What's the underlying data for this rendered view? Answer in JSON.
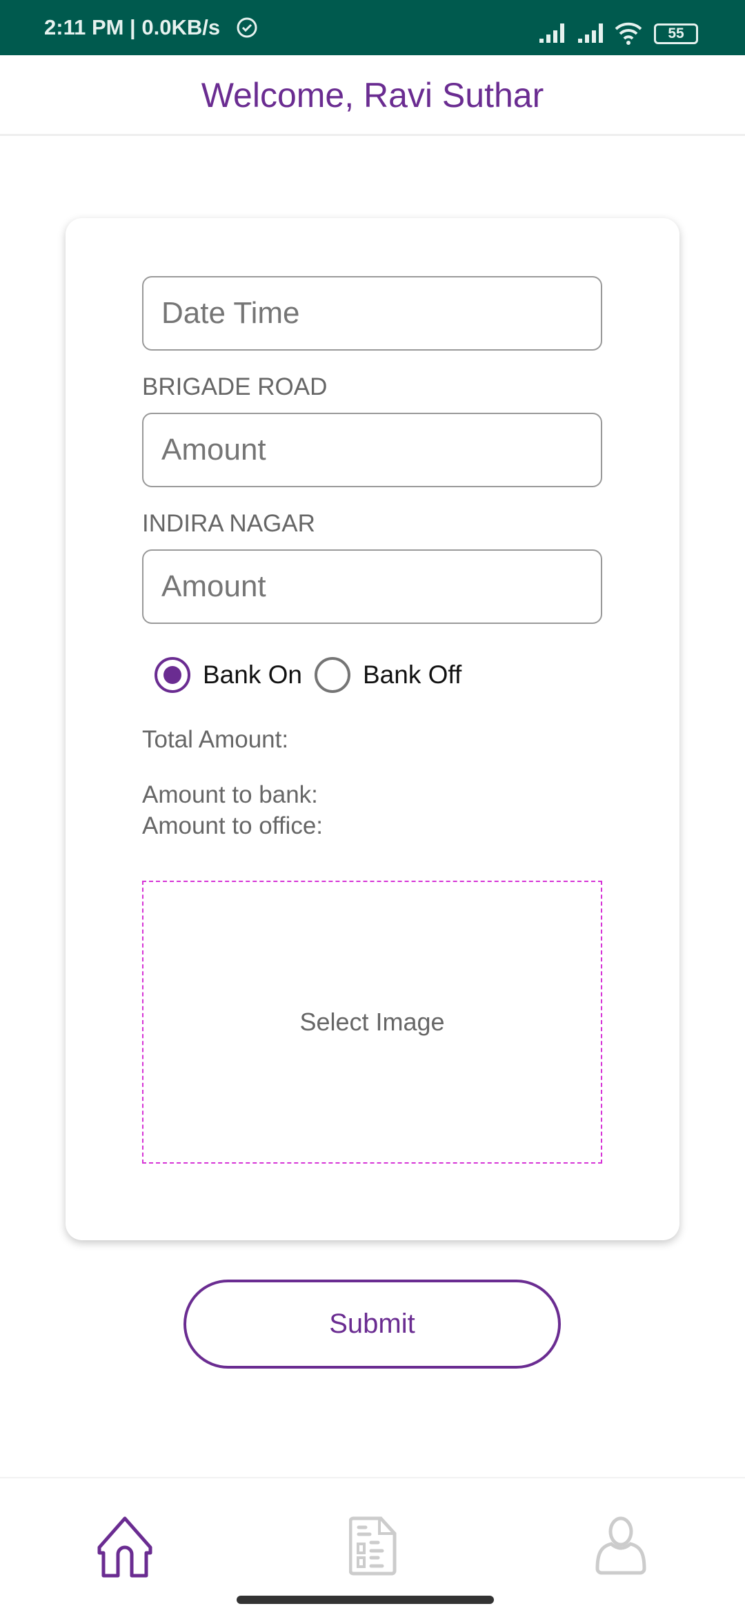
{
  "status_bar": {
    "time": "2:11 PM | 0.0KB/s",
    "battery": "55",
    "icons": [
      "alarm-icon",
      "signal-icon",
      "signal-icon",
      "wifi-icon",
      "battery-icon"
    ]
  },
  "header": {
    "title": "Welcome, Ravi Suthar"
  },
  "form": {
    "datetime_placeholder": "Date Time",
    "brigade_label": "BRIGADE ROAD",
    "brigade_placeholder": "Amount",
    "indira_label": "INDIRA NAGAR",
    "indira_placeholder": "Amount",
    "radio_bank_on": "Bank On",
    "radio_bank_off": "Bank Off",
    "selected": "Bank On",
    "total_amount": "Total Amount:",
    "amount_to_bank": "Amount to bank:",
    "amount_to_office": "Amount to office:",
    "select_image": "Select Image"
  },
  "submit_label": "Submit",
  "bottom_nav": {
    "items": [
      {
        "icon": "home-icon",
        "active": true
      },
      {
        "icon": "document-icon",
        "active": false
      },
      {
        "icon": "user-icon",
        "active": false
      }
    ]
  },
  "colors": {
    "accent": "#6a2c91",
    "status_bar": "#005a4e",
    "dashed_border": "#d633d6"
  }
}
